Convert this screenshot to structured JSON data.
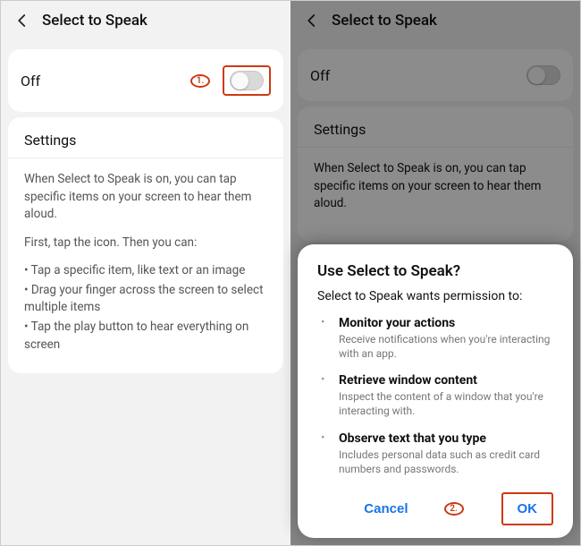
{
  "left": {
    "title": "Select to Speak",
    "toggle_label": "Off",
    "marker": "1.",
    "settings_heading": "Settings",
    "desc_p1": "When Select to Speak is on, you can tap specific items on your screen to hear them aloud.",
    "desc_p2": "First, tap the icon. Then you can:",
    "bullet1": "• Tap a specific item, like text or an image",
    "bullet2": "• Drag your finger across the screen to select multiple items",
    "bullet3": "• Tap the play button to hear everything on screen"
  },
  "right": {
    "title": "Select to Speak",
    "toggle_label": "Off",
    "settings_heading": "Settings",
    "desc_p1": "When Select to Speak is on, you can tap specific items on your screen to hear them aloud."
  },
  "dialog": {
    "title": "Use Select to Speak?",
    "subtitle": "Select to Speak wants permission to:",
    "perms": [
      {
        "title": "Monitor your actions",
        "desc": "Receive notifications when you're interacting with an app."
      },
      {
        "title": "Retrieve window content",
        "desc": "Inspect the content of a window that you're interacting with."
      },
      {
        "title": "Observe text that you type",
        "desc": "Includes personal data such as credit card numbers and passwords."
      }
    ],
    "cancel": "Cancel",
    "ok": "OK",
    "marker": "2."
  }
}
